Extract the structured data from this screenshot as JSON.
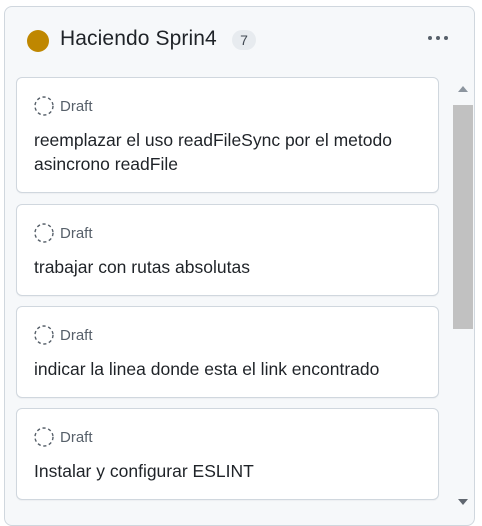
{
  "column": {
    "title": "Haciendo Sprin4",
    "count": "7",
    "status_color": "#bf8700"
  },
  "cards": [
    {
      "status": "Draft",
      "title": "reemplazar el uso readFileSync por el metodo asincrono readFile"
    },
    {
      "status": "Draft",
      "title": "trabajar con rutas absolutas"
    },
    {
      "status": "Draft",
      "title": "indicar la linea donde esta el link encontrado"
    },
    {
      "status": "Draft",
      "title": "Instalar y configurar ESLINT"
    }
  ],
  "icons": {
    "status": "circle-icon",
    "more": "kebab-horizontal-icon",
    "draft": "draft-dashed-circle-icon"
  }
}
